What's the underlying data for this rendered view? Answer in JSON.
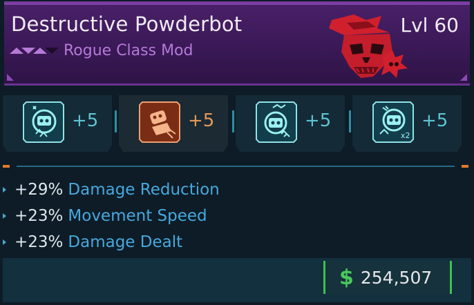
{
  "item": {
    "name": "Destructive Powderbot",
    "level": "Lvl 60",
    "type": "Rogue Class Mod",
    "rarity_color": "#b57ad8",
    "emblem": "masked-skull-emblem-icon"
  },
  "skills": [
    {
      "value": "+5",
      "icon": "bot-skill-icon",
      "color": "#5ec5d3"
    },
    {
      "value": "+5",
      "icon": "bomb-skill-icon",
      "color": "#e59a58"
    },
    {
      "value": "+5",
      "icon": "bot-skill-icon",
      "color": "#5ec5d3"
    },
    {
      "value": "+5",
      "icon": "bot-skill-icon",
      "color": "#5ec5d3"
    }
  ],
  "skill_badges": {
    "s4": "x2"
  },
  "stats": [
    {
      "value": "+29%",
      "name": "Damage Reduction"
    },
    {
      "value": "+23%",
      "name": "Movement Speed"
    },
    {
      "value": "+23%",
      "name": "Damage Dealt"
    }
  ],
  "price": {
    "symbol": "$",
    "value": "254,507",
    "color": "#3ec24e"
  }
}
